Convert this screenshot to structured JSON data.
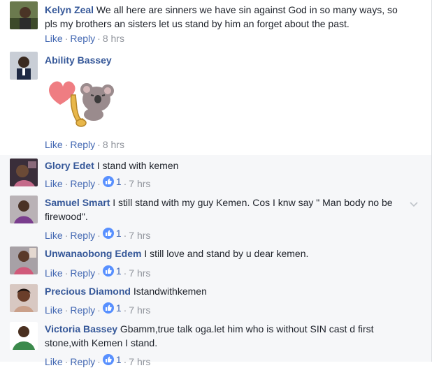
{
  "comments": [
    {
      "author": "Kelyn Zeal",
      "text": "We all here are sinners we have sin against God in so many ways, so pls my brothers an sisters let us stand by him an forget about the past.",
      "like_label": "Like",
      "reply_label": "Reply",
      "time": "8 hrs"
    },
    {
      "author": "Ability Bassey",
      "text": "",
      "sticker": "heart-koala-saxophone-sticker",
      "like_label": "Like",
      "reply_label": "Reply",
      "time": "8 hrs"
    },
    {
      "author": "Glory Edet",
      "text": "I stand with kemen",
      "like_label": "Like",
      "reply_label": "Reply",
      "likes": "1",
      "time": "7 hrs"
    },
    {
      "author": "Samuel Smart",
      "text": "I still stand with my guy Kemen. Cos I knw say \" Man body no be firewood\".",
      "like_label": "Like",
      "reply_label": "Reply",
      "likes": "1",
      "time": "7 hrs"
    },
    {
      "author": "Unwanaobong Edem",
      "text": "I still love and stand by u dear kemen.",
      "like_label": "Like",
      "reply_label": "Reply",
      "likes": "1",
      "time": "7 hrs"
    },
    {
      "author": "Precious Diamond",
      "text": "Istandwithkemen",
      "like_label": "Like",
      "reply_label": "Reply",
      "likes": "1",
      "time": "7 hrs"
    },
    {
      "author": "Victoria Bassey",
      "text": "Gbamm,true talk oga.let him who is without SIN cast d first stone,with Kemen I stand.",
      "like_label": "Like",
      "reply_label": "Reply",
      "likes": "1",
      "time": "7 hrs"
    }
  ],
  "separator": "·",
  "colors": {
    "author": "#365899",
    "link": "#4267b2",
    "meta": "#90949c",
    "text": "#1d2129",
    "row_shade": "#f6f7f9",
    "like_badge": "#5890ff"
  },
  "icons": {
    "like_badge": "thumbs-up-icon",
    "options": "chevron-down-icon"
  }
}
